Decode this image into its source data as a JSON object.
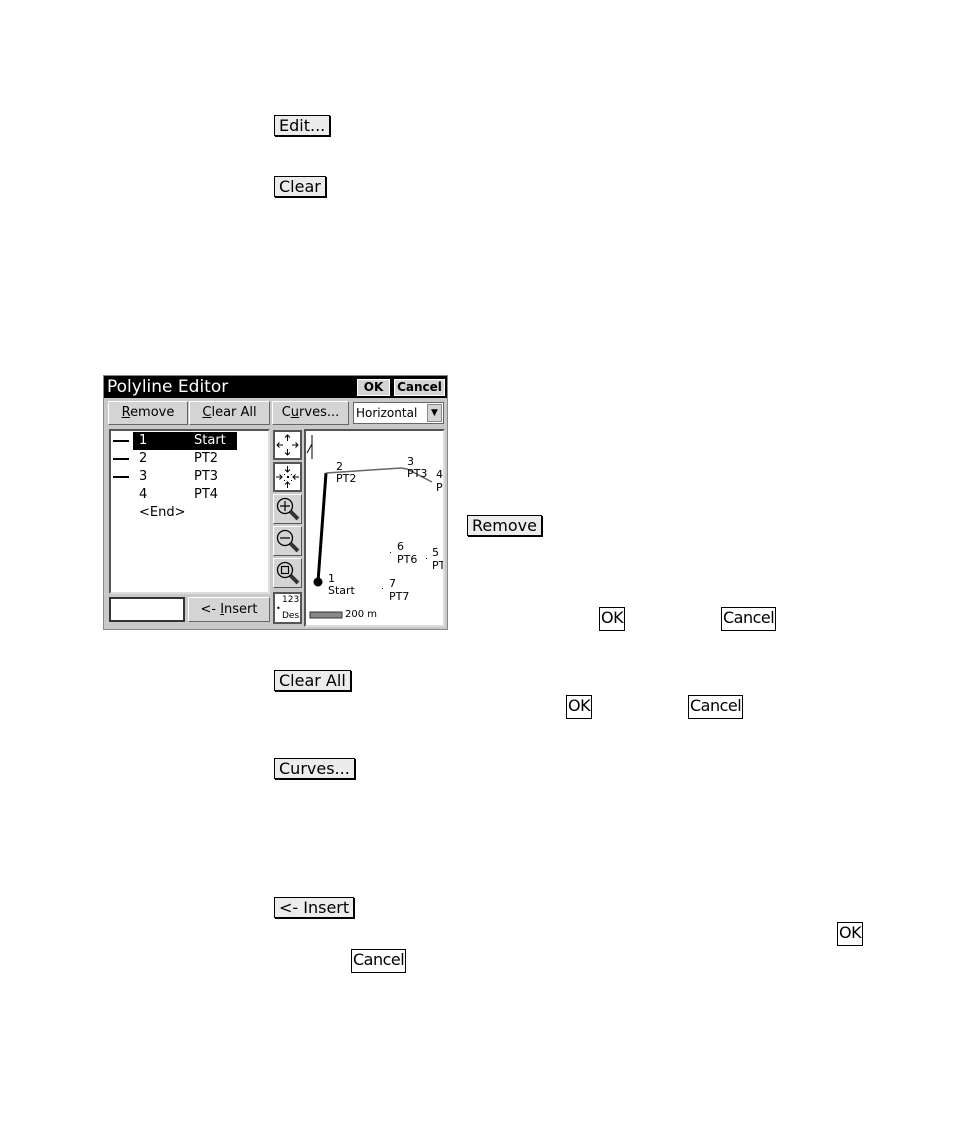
{
  "doc_buttons": {
    "edit": "Edit...",
    "clear": "Clear",
    "remove": "Remove",
    "clear_all": "Clear All",
    "curves": "Curves...",
    "insert": "<- Insert"
  },
  "doc_keys": {
    "ok_1": "OK",
    "cancel_1": "Cancel",
    "ok_2": "OK",
    "cancel_2": "Cancel",
    "ok_3": "OK",
    "cancel_3": "Cancel"
  },
  "dialog": {
    "title": "Polyline Editor",
    "ok": "OK",
    "cancel": "Cancel",
    "toolbar": {
      "remove": {
        "pre": "",
        "key": "R",
        "post": "emove"
      },
      "clear_all": {
        "pre": "",
        "key": "C",
        "post": "lear All"
      },
      "curves": {
        "pre": "C",
        "key": "u",
        "post": "rves..."
      },
      "mode_selected": "Horizontal"
    },
    "points": [
      {
        "num": "1",
        "name": "Start",
        "segment": true,
        "selected": true
      },
      {
        "num": "2",
        "name": "PT2",
        "segment": true,
        "selected": false
      },
      {
        "num": "3",
        "name": "PT3",
        "segment": true,
        "selected": false
      },
      {
        "num": "4",
        "name": "PT4",
        "segment": false,
        "selected": false
      }
    ],
    "end_label": "<End>",
    "point_input_value": "",
    "insert": {
      "pre": "<- ",
      "key": "I",
      "post": "nsert"
    },
    "des_button": {
      "top": "123",
      "bottom": "Des"
    },
    "map": {
      "north": "N",
      "scale": "200 m",
      "labels": [
        {
          "num": "2",
          "name": "PT2"
        },
        {
          "num": "3",
          "name": "PT3"
        },
        {
          "num": "4",
          "name": "P"
        },
        {
          "num": "6",
          "name": "PT6"
        },
        {
          "num": "5",
          "name": "PT"
        },
        {
          "num": "1",
          "name": "Start"
        },
        {
          "num": "7",
          "name": "PT7"
        }
      ]
    }
  }
}
